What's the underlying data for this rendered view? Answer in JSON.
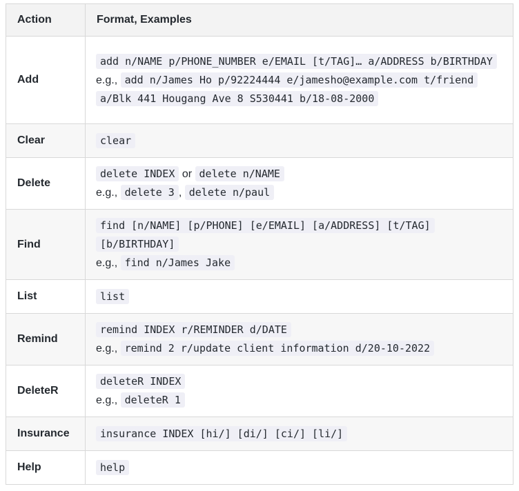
{
  "header": {
    "action": "Action",
    "format": "Format, Examples"
  },
  "eg_label": "e.g.,",
  "or_label": "or",
  "comma": ",",
  "rows": [
    {
      "action": "Add",
      "format": "add n/NAME p/PHONE_NUMBER e/EMAIL [t/TAG]… a/ADDRESS b/BIRTHDAY",
      "example": "add n/James Ho p/92224444 e/jamesho@example.com t/friend a/Blk 441 Hougang Ave 8 S530441 b/18-08-2000"
    },
    {
      "action": "Clear",
      "format": "clear"
    },
    {
      "action": "Delete",
      "format": "delete INDEX",
      "format_alt": "delete n/NAME",
      "example": "delete 3",
      "example_alt": "delete n/paul"
    },
    {
      "action": "Find",
      "format": "find [n/NAME] [p/PHONE] [e/EMAIL] [a/ADDRESS] [t/TAG] [b/BIRTHDAY]",
      "example": "find n/James Jake"
    },
    {
      "action": "List",
      "format": "list"
    },
    {
      "action": "Remind",
      "format": "remind INDEX r/REMINDER d/DATE",
      "example": "remind 2 r/update client information d/20-10-2022"
    },
    {
      "action": "DeleteR",
      "format": "deleteR INDEX",
      "example": "deleteR 1"
    },
    {
      "action": "Insurance",
      "format": "insurance INDEX [hi/] [di/] [ci/] [li/]"
    },
    {
      "action": "Help",
      "format": "help"
    }
  ]
}
